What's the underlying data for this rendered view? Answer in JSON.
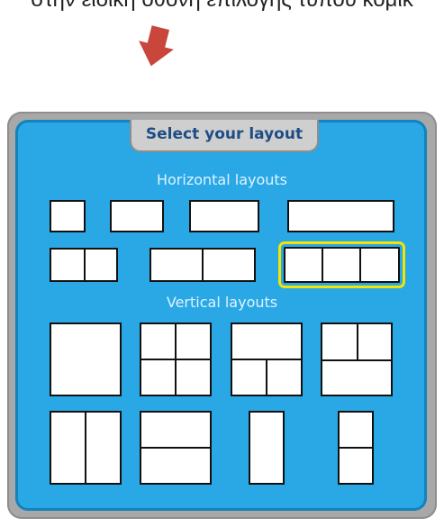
{
  "caption": "στην ειδική οθόνη επιλογής τύπου κόμικ",
  "colors": {
    "accent": "#2aa8e6",
    "selected": "#f5e400",
    "arrow": "#c9463d"
  },
  "dialog": {
    "title": "Select your layout",
    "horizontal_label": "Horizontal layouts",
    "vertical_label": "Vertical layouts"
  },
  "layouts": {
    "horizontal": [
      "1-panel-small",
      "1-panel-medium",
      "1-panel-wide",
      "1-panel-extra-wide",
      "2-panel",
      "2-panel-wide",
      "3-panel"
    ],
    "vertical": [
      "1-panel-square",
      "4-grid",
      "top-wide-bottom-split",
      "top-split-bottom-wide",
      "2-column",
      "2-row",
      "1-panel-tall",
      "2-row-narrow"
    ],
    "selected": "3-panel"
  }
}
